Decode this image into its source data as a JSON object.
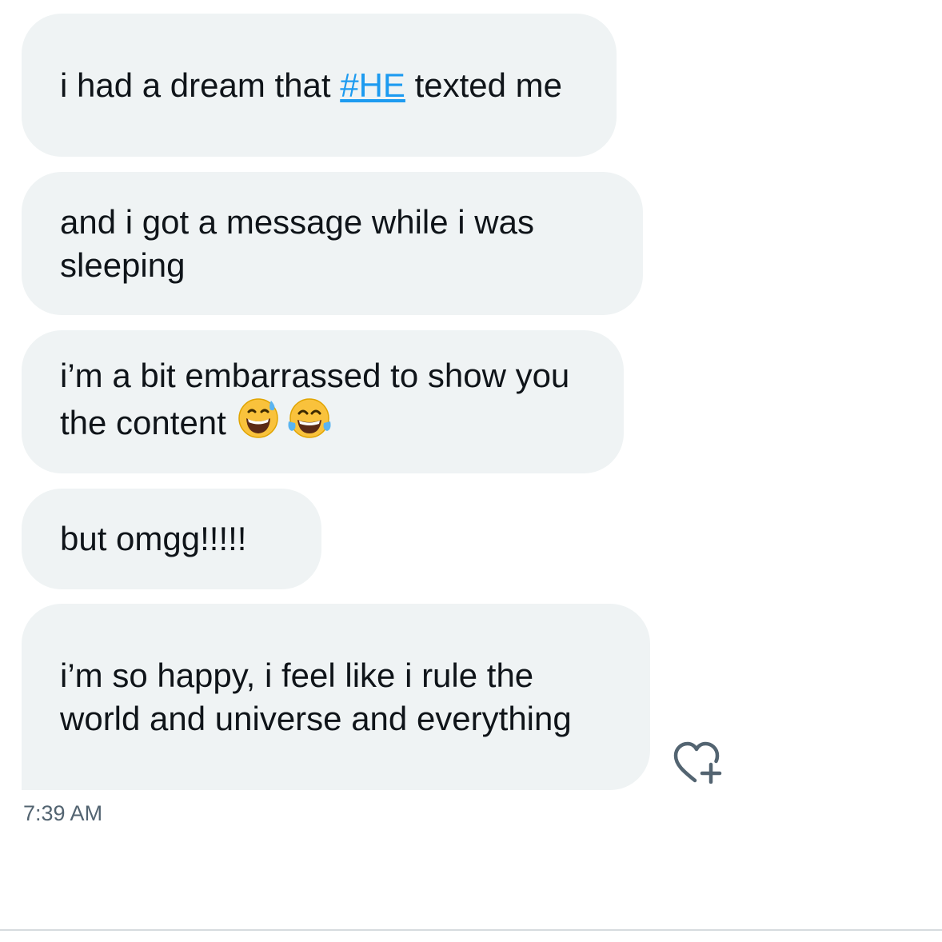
{
  "colors": {
    "bubble_bg": "#eff3f4",
    "text": "#0f1419",
    "hashtag": "#1d9bf0",
    "timestamp": "#536471"
  },
  "messages": [
    {
      "text_before": "i had a dream that ",
      "hashtag": "#HE",
      "text_after": " texted me"
    },
    {
      "text": "and i got a message while i was sleeping"
    },
    {
      "text": "i’m a bit embarrassed to show you the content",
      "emojis": [
        "grinning-face-with-sweat",
        "face-with-tears-of-joy"
      ]
    },
    {
      "text": "but omgg!!!!!"
    },
    {
      "text": "i’m so happy, i feel like i rule the world and universe and everything"
    }
  ],
  "timestamp": "7:39 AM",
  "reaction_icon": "heart-plus-icon"
}
